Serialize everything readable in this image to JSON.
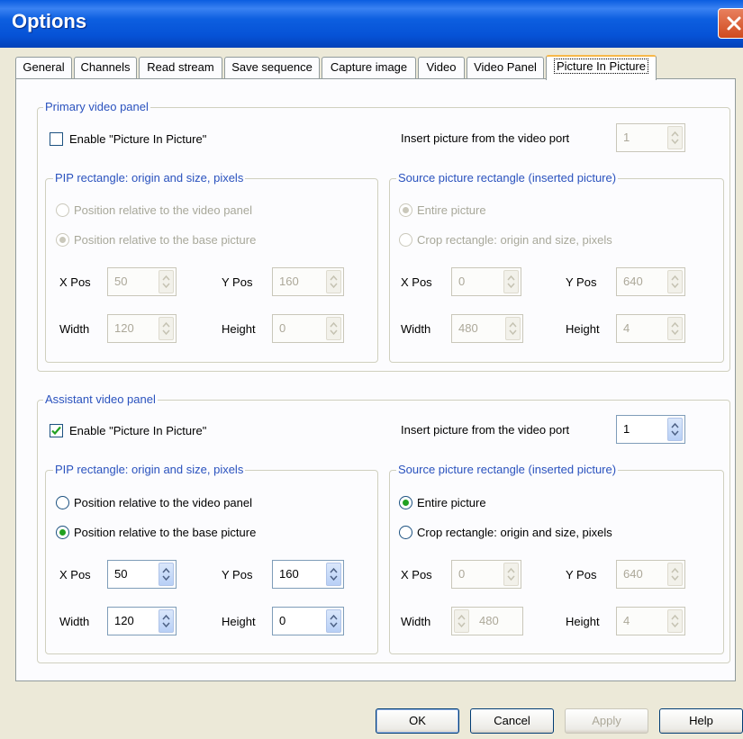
{
  "window": {
    "title": "Options"
  },
  "tabs": [
    {
      "label": "General"
    },
    {
      "label": "Channels"
    },
    {
      "label": "Read stream"
    },
    {
      "label": "Save sequence"
    },
    {
      "label": "Capture image"
    },
    {
      "label": "Video"
    },
    {
      "label": "Video Panel"
    },
    {
      "label": "Picture In Picture",
      "active": true
    }
  ],
  "primary": {
    "legend": "Primary video panel",
    "enable_label": "Enable \"Picture In Picture\"",
    "enable_checked": false,
    "insert_label": "Insert picture from the video port",
    "insert_value": "1",
    "pip": {
      "legend": "PIP rectangle: origin and size, pixels",
      "radio1": "Position relative to the video panel",
      "radio2": "Position relative to the base picture",
      "xpos_label": "X Pos",
      "xpos": "50",
      "ypos_label": "Y Pos",
      "ypos": "160",
      "width_label": "Width",
      "width": "120",
      "height_label": "Height",
      "height": "0"
    },
    "source": {
      "legend": "Source picture rectangle (inserted picture)",
      "radio1": "Entire picture",
      "radio2": "Crop rectangle: origin and size, pixels",
      "xpos_label": "X Pos",
      "xpos": "0",
      "ypos_label": "Y Pos",
      "ypos": "640",
      "width_label": "Width",
      "width": "480",
      "height_label": "Height",
      "height": "4"
    }
  },
  "assistant": {
    "legend": "Assistant video panel",
    "enable_label": "Enable \"Picture In Picture\"",
    "enable_checked": true,
    "insert_label": "Insert picture from the video port",
    "insert_value": "1",
    "pip": {
      "legend": "PIP rectangle: origin and size, pixels",
      "radio1": "Position relative to the video panel",
      "radio2": "Position relative to the base picture",
      "xpos_label": "X Pos",
      "xpos": "50",
      "ypos_label": "Y Pos",
      "ypos": "160",
      "width_label": "Width",
      "width": "120",
      "height_label": "Height",
      "height": "0"
    },
    "source": {
      "legend": "Source picture rectangle (inserted picture)",
      "radio1": "Entire picture",
      "radio2": "Crop rectangle: origin and size, pixels",
      "xpos_label": "X Pos",
      "xpos": "0",
      "ypos_label": "Y Pos",
      "ypos": "640",
      "width_label": "Width",
      "width": "480",
      "height_label": "Height",
      "height": "4"
    }
  },
  "buttons": {
    "ok": "OK",
    "cancel": "Cancel",
    "apply": "Apply",
    "help": "Help"
  },
  "colors": {
    "titlebar": "#0652d6",
    "legend_text": "#2a52be",
    "radio_dot": "#21a121",
    "check_mark": "#21a121",
    "close_button": "#d04a1e"
  }
}
